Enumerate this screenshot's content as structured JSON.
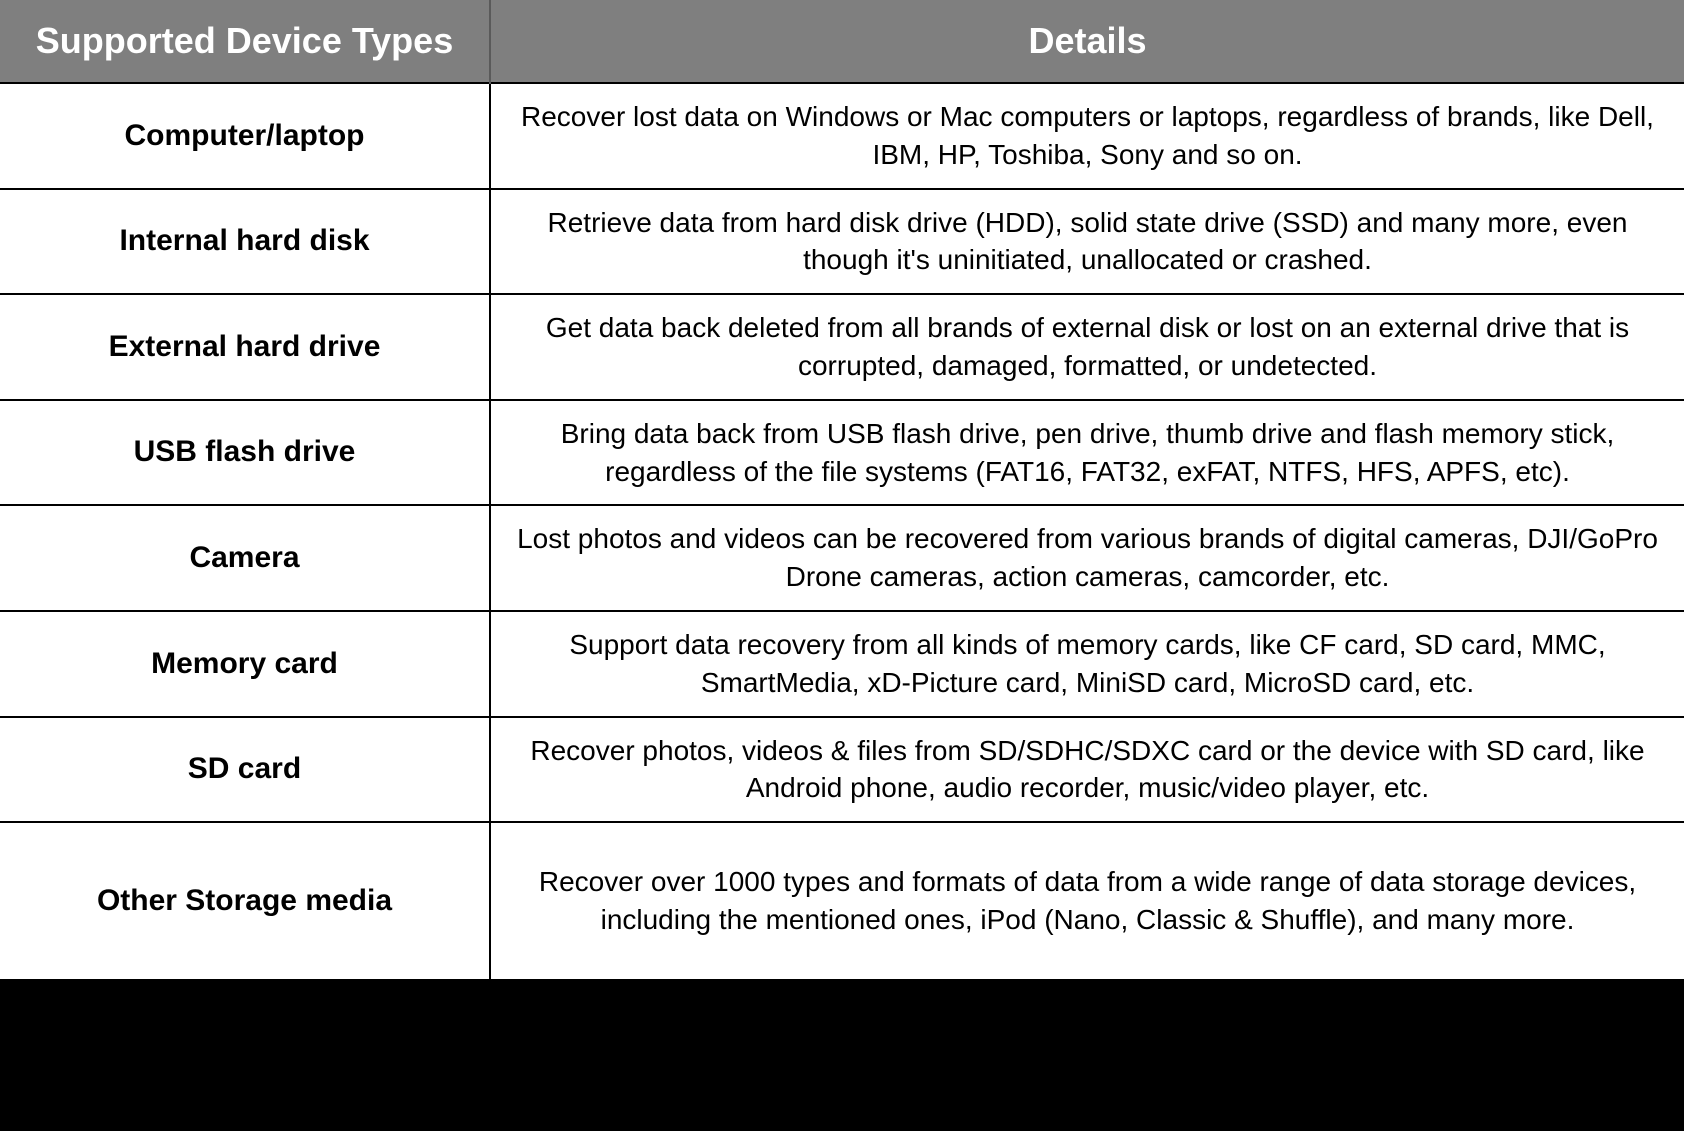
{
  "table": {
    "headers": {
      "col0": "Supported Device Types",
      "col1": "Details"
    },
    "rows": [
      {
        "type": "Computer/laptop",
        "details": "Recover lost data on Windows or Mac computers or laptops, regardless of brands, like Dell, IBM, HP, Toshiba, Sony and so on."
      },
      {
        "type": "Internal hard disk",
        "details": "Retrieve data from hard disk drive (HDD), solid state drive (SSD) and many more, even though it's uninitiated, unallocated or crashed."
      },
      {
        "type": "External hard drive",
        "details": "Get data back deleted from all brands of external disk or lost on an external drive that is corrupted, damaged, formatted, or undetected."
      },
      {
        "type": "USB flash drive",
        "details": "Bring data back from USB flash drive, pen drive, thumb drive and flash memory stick, regardless of the file systems (FAT16, FAT32, exFAT, NTFS, HFS, APFS, etc)."
      },
      {
        "type": "Camera",
        "details": "Lost photos and videos can be recovered from various brands of digital cameras, DJI/GoPro Drone cameras, action cameras, camcorder, etc."
      },
      {
        "type": "Memory card",
        "details": "Support data recovery from all kinds of memory cards, like CF card, SD card, MMC, SmartMedia, xD-Picture card, MiniSD card, MicroSD card, etc."
      },
      {
        "type": "SD card",
        "details": "Recover photos, videos & files from SD/SDHC/SDXC card or the device with SD card, like Android phone, audio recorder, music/video player, etc."
      },
      {
        "type": "Other Storage media",
        "details": "Recover over 1000 types and formats of data from a wide range of data storage devices, including the mentioned ones, iPod (Nano, Classic & Shuffle), and many more."
      }
    ]
  }
}
